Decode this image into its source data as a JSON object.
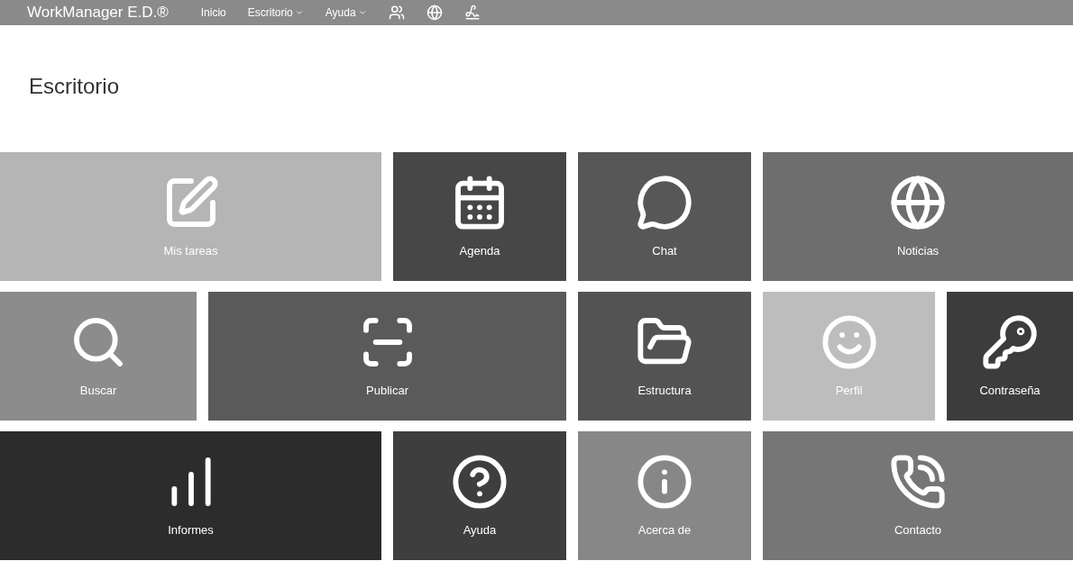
{
  "navbar": {
    "brand": "WorkManager E.D.®",
    "items": [
      {
        "label": "Inicio",
        "dropdown": false
      },
      {
        "label": "Escritorio",
        "dropdown": true
      },
      {
        "label": "Ayuda",
        "dropdown": true
      }
    ]
  },
  "page_title": "Escritorio",
  "tile_rows": [
    [
      {
        "label": "Mis tareas",
        "kind": "tasks",
        "color": "#b5b5b5"
      },
      {
        "label": "Agenda",
        "kind": "calendar",
        "color": "#474747"
      },
      {
        "label": "Chat",
        "kind": "chat",
        "color": "#575757"
      },
      {
        "label": "Noticias",
        "kind": "globe",
        "color": "#6e6e6e"
      }
    ],
    [
      {
        "label": "Buscar",
        "kind": "search",
        "color": "#8c8c8c"
      },
      {
        "label": "Publicar",
        "kind": "scanner",
        "color": "#5a5a5a"
      },
      {
        "label": "Estructura",
        "kind": "folder",
        "color": "#535353"
      },
      {
        "label": "Perfil",
        "kind": "smile",
        "color": "#bdbdbd"
      },
      {
        "label": "Contraseña",
        "kind": "key",
        "color": "#3c3c3c"
      }
    ],
    [
      {
        "label": "Informes",
        "kind": "chart",
        "color": "#2c2c2c"
      },
      {
        "label": "Ayuda",
        "kind": "help",
        "color": "#3e3e3e"
      },
      {
        "label": "Acerca de",
        "kind": "info",
        "color": "#878787"
      },
      {
        "label": "Contacto",
        "kind": "phone",
        "color": "#767676"
      }
    ]
  ]
}
